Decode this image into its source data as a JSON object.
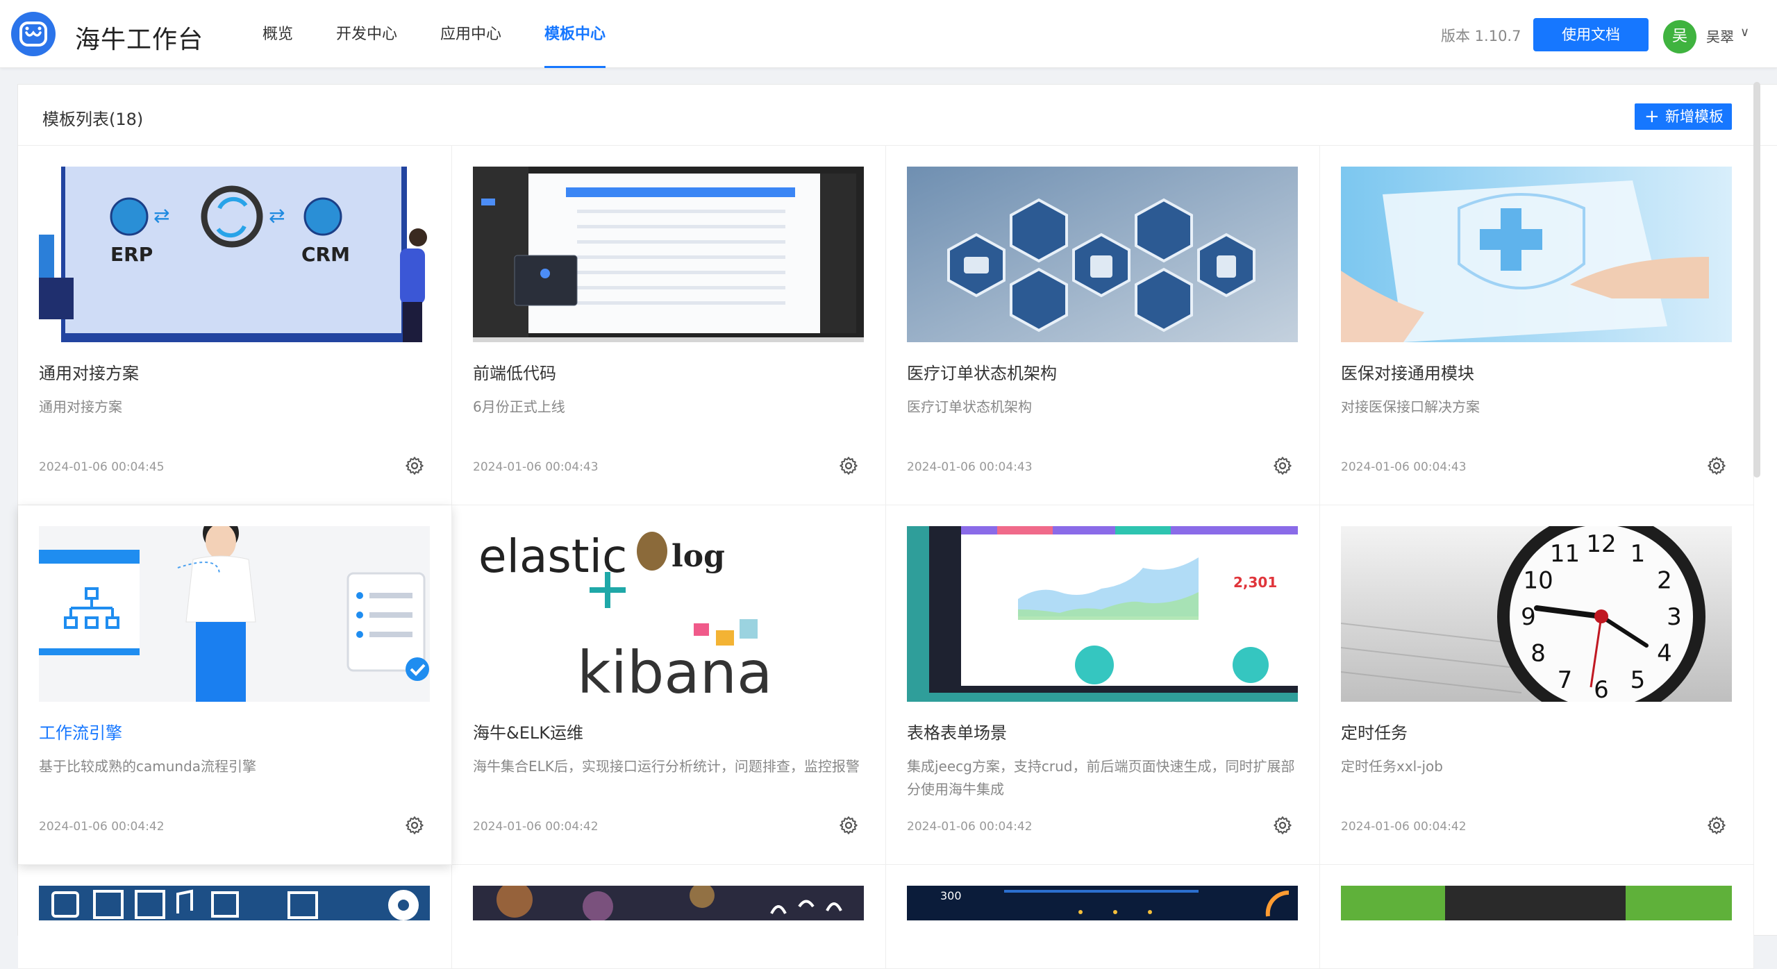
{
  "header": {
    "app_title": "海牛工作台",
    "nav": [
      "概览",
      "开发中心",
      "应用中心",
      "模板中心"
    ],
    "active_nav": 3,
    "version": "版本 1.10.7",
    "docs_button": "使用文档",
    "user_avatar_text": "吴",
    "user_name": "吴翠",
    "user_caret": "∨",
    "accent_color": "#1677ff"
  },
  "panel": {
    "title": "模板列表(18)",
    "add_button": "新增模板",
    "add_icon": "+"
  },
  "cards": [
    {
      "title": "通用对接方案",
      "desc": "通用对接方案",
      "time": "2024-01-06 00:04:45"
    },
    {
      "title": "前端低代码",
      "desc": "6月份正式上线",
      "time": "2024-01-06 00:04:43"
    },
    {
      "title": "医疗订单状态机架构",
      "desc": "医疗订单状态机架构",
      "time": "2024-01-06 00:04:43"
    },
    {
      "title": "医保对接通用模块",
      "desc": "对接医保接口解决方案",
      "time": "2024-01-06 00:04:43"
    },
    {
      "title": "工作流引擎",
      "desc": "基于比较成熟的camunda流程引擎",
      "time": "2024-01-06 00:04:42"
    },
    {
      "title": "海牛&ELK运维",
      "desc": "海牛集合ELK后，实现接口运行分析统计，问题排查，监控报警",
      "time": "2024-01-06 00:04:42"
    },
    {
      "title": "表格表单场景",
      "desc": "集成jeecg方案，支持crud，前后端页面快速生成，同时扩展部分使用海牛集成",
      "time": "2024-01-06 00:04:42"
    },
    {
      "title": "定时任务",
      "desc": "定时任务xxl-job",
      "time": "2024-01-06 00:04:42"
    }
  ],
  "thumb_text": {
    "erp": "ERP",
    "crm": "CRM",
    "elastic": "elastic",
    "logstash": "log",
    "kibana": "kibana",
    "dashboard_value": "2,301",
    "aqi_value": "300",
    "clock_numbers": [
      "12",
      "1",
      "2",
      "3",
      "4",
      "5",
      "6",
      "7",
      "8",
      "9",
      "10",
      "11"
    ]
  }
}
